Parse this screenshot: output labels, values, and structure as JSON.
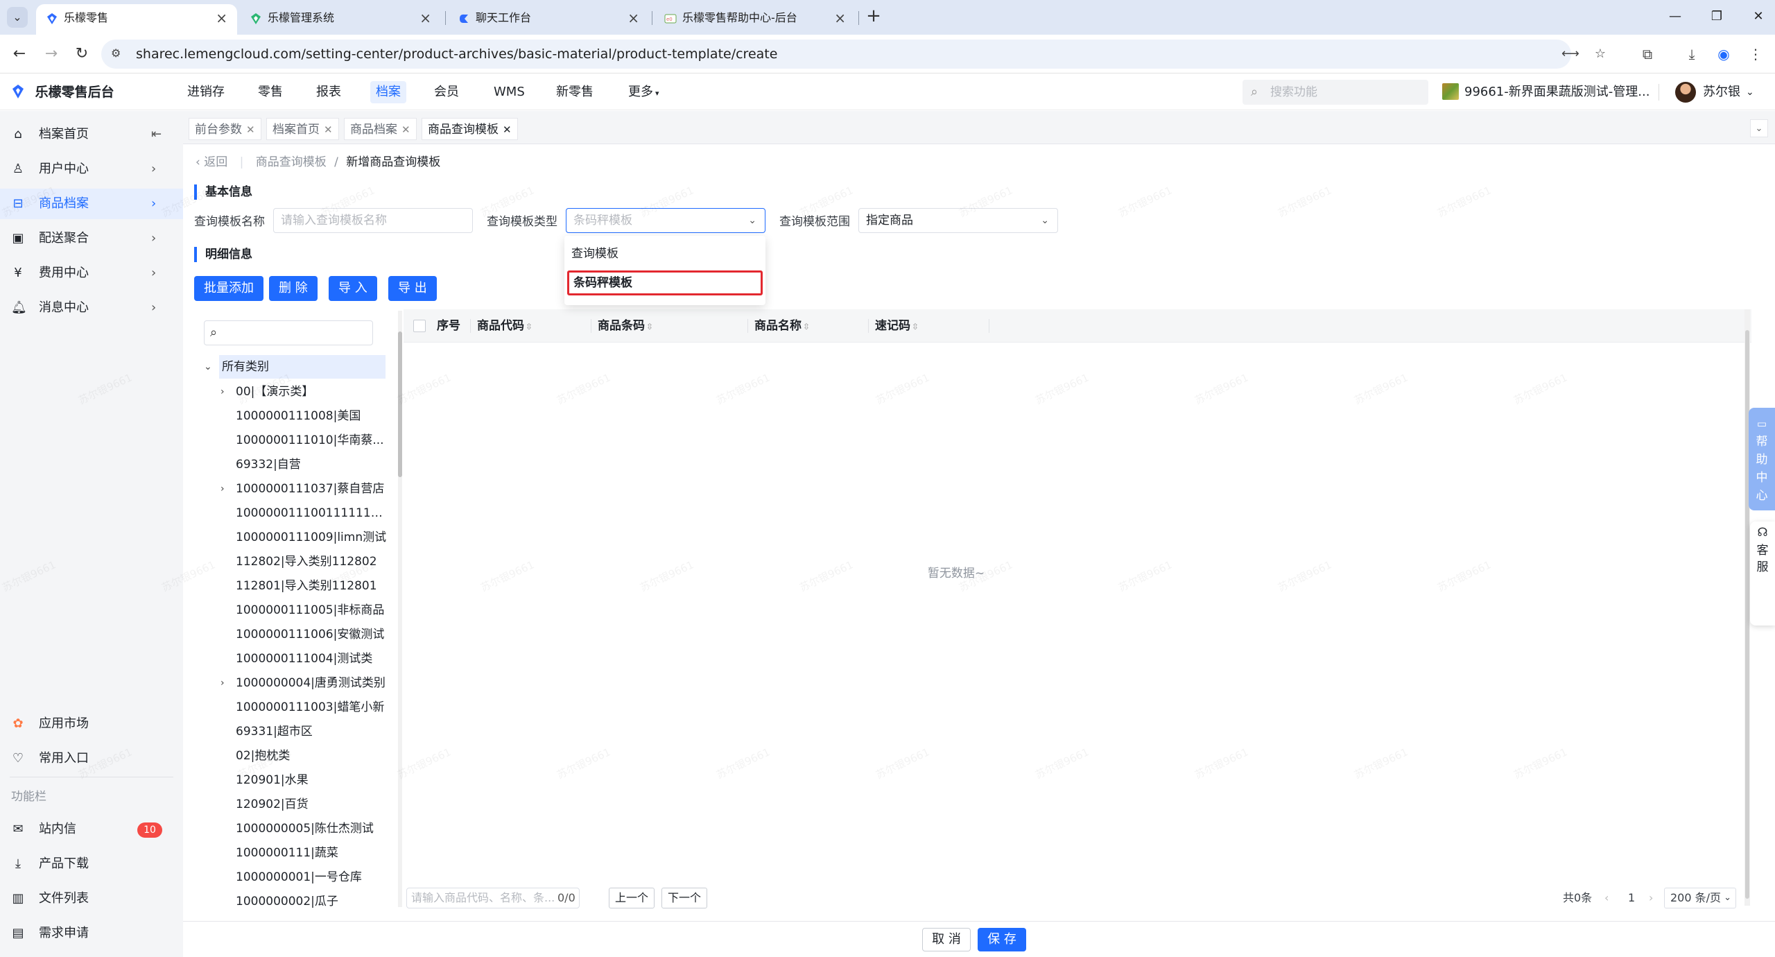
{
  "browser": {
    "tabs": [
      {
        "title": "乐檬零售",
        "active": true
      },
      {
        "title": "乐檬管理系统",
        "active": false
      },
      {
        "title": "聊天工作台",
        "active": false
      },
      {
        "title": "乐檬零售帮助中心-后台",
        "active": false
      }
    ],
    "url": "sharec.lemengcloud.com/setting-center/product-archives/basic-material/product-template/create"
  },
  "header": {
    "logo": "乐檬零售后台",
    "nav": [
      "进销存",
      "零售",
      "报表",
      "档案",
      "会员",
      "WMS",
      "新零售",
      "更多"
    ],
    "active_nav": "档案",
    "search_placeholder": "搜索功能",
    "store": "99661-新界面果蔬版测试-管理...",
    "user": "苏尔银"
  },
  "sidebar": {
    "items": [
      {
        "label": "档案首页",
        "icon": "home-icon"
      },
      {
        "label": "用户中心",
        "icon": "user-icon"
      },
      {
        "label": "商品档案",
        "icon": "product-icon",
        "active": true
      },
      {
        "label": "配送聚合",
        "icon": "delivery-icon"
      },
      {
        "label": "费用中心",
        "icon": "fee-icon"
      },
      {
        "label": "消息中心",
        "icon": "bell-icon"
      }
    ],
    "bottom_items": [
      {
        "label": "应用市场",
        "icon": "app-market-icon"
      },
      {
        "label": "常用入口",
        "icon": "heart-icon"
      }
    ],
    "section_label": "功能栏",
    "function_items": [
      {
        "label": "站内信",
        "icon": "mail-icon",
        "badge": "10"
      },
      {
        "label": "产品下载",
        "icon": "download-icon"
      },
      {
        "label": "文件列表",
        "icon": "file-list-icon"
      },
      {
        "label": "需求申请",
        "icon": "request-icon"
      }
    ]
  },
  "page_tabs": [
    {
      "label": "前台参数"
    },
    {
      "label": "档案首页"
    },
    {
      "label": "商品档案"
    },
    {
      "label": "商品查询模板",
      "active": true
    }
  ],
  "breadcrumb": {
    "back": "返回",
    "parent": "商品查询模板",
    "separator": "/",
    "current": "新增商品查询模板"
  },
  "basic_info": {
    "title": "基本信息",
    "name_label": "查询模板名称",
    "name_placeholder": "请输入查询模板名称",
    "type_label": "查询模板类型",
    "type_value": "条码秤模板",
    "range_label": "查询模板范围",
    "range_value": "指定商品"
  },
  "dropdown": {
    "options": [
      "查询模板",
      "条码秤模板"
    ],
    "selected": "条码秤模板"
  },
  "detail": {
    "title": "明细信息",
    "buttons": [
      "批量添加",
      "删 除",
      "导 入",
      "导 出"
    ]
  },
  "tree": {
    "root": "所有类别",
    "nodes": [
      {
        "label": "00|【演示类】",
        "expandable": true
      },
      {
        "label": "1000000111008|美国",
        "expandable": false
      },
      {
        "label": "1000000111010|华南蔡...",
        "expandable": false
      },
      {
        "label": "69332|自营",
        "expandable": false
      },
      {
        "label": "1000000111037|蔡自营店",
        "expandable": true
      },
      {
        "label": "10000001110011111111|...",
        "expandable": false
      },
      {
        "label": "1000000111009|limn测试",
        "expandable": false
      },
      {
        "label": "112802|导入类别112802",
        "expandable": false
      },
      {
        "label": "112801|导入类别112801",
        "expandable": false
      },
      {
        "label": "1000000111005|非标商品",
        "expandable": false
      },
      {
        "label": "1000000111006|安徽测试",
        "expandable": false
      },
      {
        "label": "1000000111004|测试类",
        "expandable": false
      },
      {
        "label": "1000000004|唐勇测试类别",
        "expandable": true
      },
      {
        "label": "1000000111003|蜡笔小新",
        "expandable": false
      },
      {
        "label": "69331|超市区",
        "expandable": false
      },
      {
        "label": "02|抱枕类",
        "expandable": false
      },
      {
        "label": "120901|水果",
        "expandable": false
      },
      {
        "label": "120902|百货",
        "expandable": false
      },
      {
        "label": "1000000005|陈仕杰测试",
        "expandable": false
      },
      {
        "label": "1000000111|蔬菜",
        "expandable": false
      },
      {
        "label": "1000000001|一号仓库",
        "expandable": false
      },
      {
        "label": "1000000002|瓜子",
        "expandable": false
      }
    ]
  },
  "table": {
    "columns": [
      "序号",
      "商品代码",
      "商品条码",
      "商品名称",
      "速记码"
    ],
    "empty_text": "暂无数据~",
    "find_placeholder": "请输入商品代码、名称、条...",
    "find_count": "0/0",
    "prev": "上一个",
    "next": "下一个",
    "total": "共0条",
    "page": "1",
    "page_size": "200 条/页"
  },
  "footer": {
    "cancel": "取 消",
    "save": "保 存"
  },
  "float": {
    "help": "帮助中心",
    "service": "客服"
  },
  "watermark": "苏尔银9661"
}
